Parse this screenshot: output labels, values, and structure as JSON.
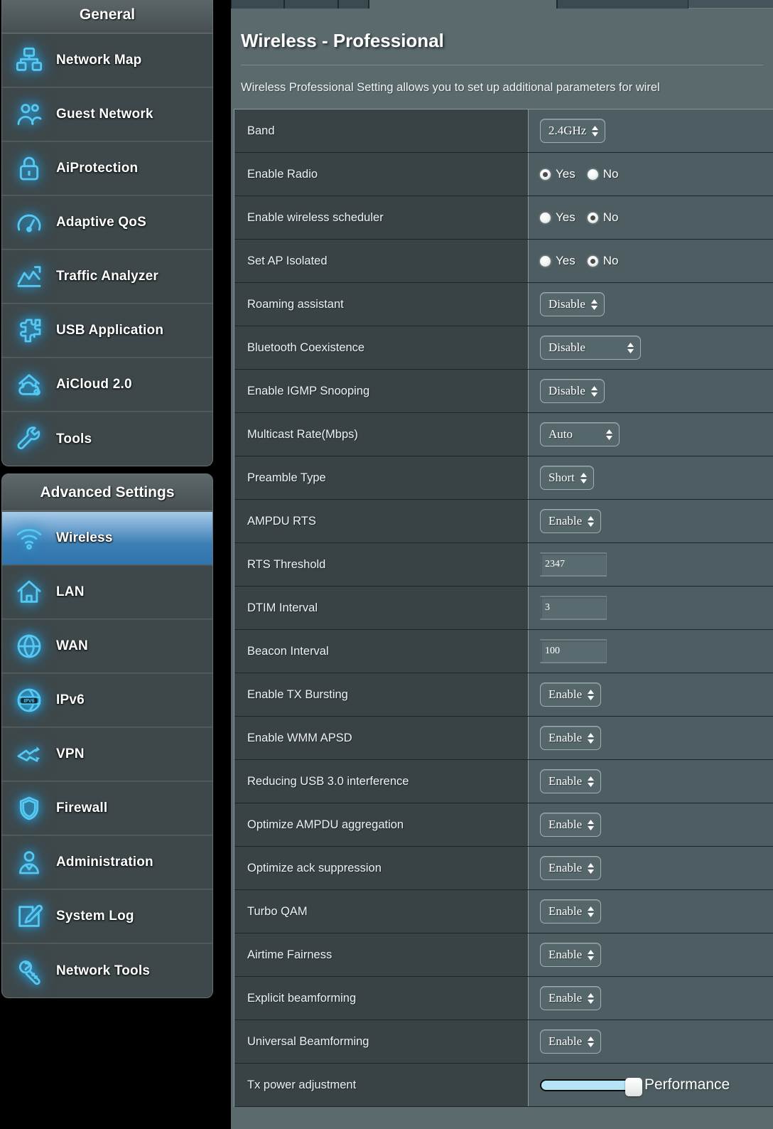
{
  "sidebar": {
    "general": {
      "title": "General",
      "items": [
        {
          "label": "Network Map",
          "icon": "network-map-icon"
        },
        {
          "label": "Guest Network",
          "icon": "guest-network-icon"
        },
        {
          "label": "AiProtection",
          "icon": "lock-icon"
        },
        {
          "label": "Adaptive QoS",
          "icon": "gauge-icon"
        },
        {
          "label": "Traffic Analyzer",
          "icon": "chart-icon"
        },
        {
          "label": "USB Application",
          "icon": "puzzle-icon"
        },
        {
          "label": "AiCloud 2.0",
          "icon": "cloud-home-icon"
        },
        {
          "label": "Tools",
          "icon": "wrench-icon"
        }
      ]
    },
    "advanced": {
      "title": "Advanced Settings",
      "items": [
        {
          "label": "Wireless",
          "icon": "wifi-icon",
          "active": true
        },
        {
          "label": "LAN",
          "icon": "home-icon",
          "active": false
        },
        {
          "label": "WAN",
          "icon": "globe-icon",
          "active": false
        },
        {
          "label": "IPv6",
          "icon": "ipv6-globe-icon",
          "active": false
        },
        {
          "label": "VPN",
          "icon": "vpn-key-icon",
          "active": false
        },
        {
          "label": "Firewall",
          "icon": "shield-icon",
          "active": false
        },
        {
          "label": "Administration",
          "icon": "user-icon",
          "active": false
        },
        {
          "label": "System Log",
          "icon": "pencil-note-icon",
          "active": false
        },
        {
          "label": "Network Tools",
          "icon": "network-wrench-icon",
          "active": false
        }
      ]
    }
  },
  "main": {
    "title": "Wireless - Professional",
    "description": "Wireless Professional Setting allows you to set up additional parameters for wirel",
    "rows": [
      {
        "label": "Band",
        "type": "select",
        "value": "2.4GHz",
        "width": "auto"
      },
      {
        "label": "Enable Radio",
        "type": "radio",
        "options": [
          "Yes",
          "No"
        ],
        "selected": "Yes"
      },
      {
        "label": "Enable wireless scheduler",
        "type": "radio",
        "options": [
          "Yes",
          "No"
        ],
        "selected": "No"
      },
      {
        "label": "Set AP Isolated",
        "type": "radio",
        "options": [
          "Yes",
          "No"
        ],
        "selected": "No"
      },
      {
        "label": "Roaming assistant",
        "type": "select",
        "value": "Disable",
        "width": "auto"
      },
      {
        "label": "Bluetooth Coexistence",
        "type": "select",
        "value": "Disable",
        "width": "wide"
      },
      {
        "label": "Enable IGMP Snooping",
        "type": "select",
        "value": "Disable",
        "width": "auto"
      },
      {
        "label": "Multicast Rate(Mbps)",
        "type": "select",
        "value": "Auto",
        "width": "mid"
      },
      {
        "label": "Preamble Type",
        "type": "select",
        "value": "Short",
        "width": "auto"
      },
      {
        "label": "AMPDU RTS",
        "type": "select",
        "value": "Enable",
        "width": "auto"
      },
      {
        "label": "RTS Threshold",
        "type": "text",
        "value": "2347"
      },
      {
        "label": "DTIM Interval",
        "type": "text",
        "value": "3"
      },
      {
        "label": "Beacon Interval",
        "type": "text",
        "value": "100"
      },
      {
        "label": "Enable TX Bursting",
        "type": "select",
        "value": "Enable",
        "width": "auto"
      },
      {
        "label": "Enable WMM APSD",
        "type": "select",
        "value": "Enable",
        "width": "auto"
      },
      {
        "label": "Reducing USB 3.0 interference",
        "type": "select",
        "value": "Enable",
        "width": "auto"
      },
      {
        "label": "Optimize AMPDU aggregation",
        "type": "select",
        "value": "Enable",
        "width": "auto"
      },
      {
        "label": "Optimize ack suppression",
        "type": "select",
        "value": "Enable",
        "width": "auto"
      },
      {
        "label": "Turbo QAM",
        "type": "select",
        "value": "Enable",
        "width": "auto"
      },
      {
        "label": "Airtime Fairness",
        "type": "select",
        "value": "Enable",
        "width": "auto"
      },
      {
        "label": "Explicit beamforming",
        "type": "select",
        "value": "Enable",
        "width": "auto"
      },
      {
        "label": "Universal Beamforming",
        "type": "select",
        "value": "Enable",
        "width": "auto"
      },
      {
        "label": "Tx power adjustment",
        "type": "slider",
        "value": "Performance",
        "percent": 100
      }
    ]
  },
  "colors": {
    "accent_blue": "#57c8f2",
    "active_item": "#3d7fb5",
    "panel_bg": "#5b6a6d",
    "label_cell": "#394244",
    "value_cell": "#4d5d61",
    "slider_track": "#b6e4f7"
  }
}
